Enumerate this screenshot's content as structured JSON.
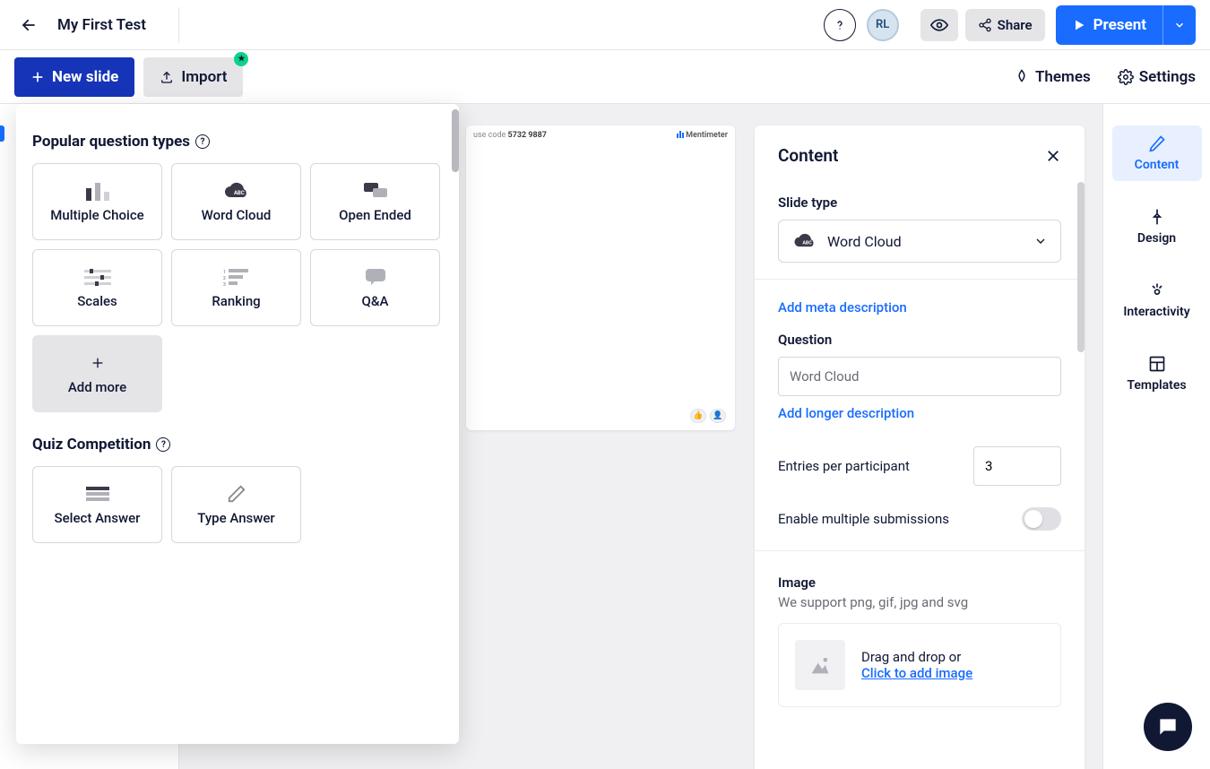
{
  "header": {
    "title": "My First Test",
    "avatar_initials": "RL",
    "share_label": "Share",
    "present_label": "Present"
  },
  "secondbar": {
    "new_slide_label": "New slide",
    "import_label": "Import",
    "themes_label": "Themes",
    "settings_label": "Settings"
  },
  "popover": {
    "popular_title": "Popular question types",
    "quiz_title": "Quiz Competition",
    "cards": {
      "multiple_choice": "Multiple Choice",
      "word_cloud": "Word Cloud",
      "open_ended": "Open Ended",
      "scales": "Scales",
      "ranking": "Ranking",
      "qa": "Q&A",
      "add_more": "Add more",
      "select_answer": "Select Answer",
      "type_answer": "Type Answer"
    }
  },
  "preview": {
    "use_code_prefix": "use code",
    "code": "5732 9887",
    "brand": "Mentimeter"
  },
  "content_panel": {
    "title": "Content",
    "slide_type_label": "Slide type",
    "slide_type_value": "Word Cloud",
    "add_meta_link": "Add meta description",
    "question_label": "Question",
    "question_value": "Word Cloud",
    "add_longer_link": "Add longer description",
    "entries_label": "Entries per participant",
    "entries_value": "3",
    "multi_submit_label": "Enable multiple submissions",
    "multi_submit_enabled": false,
    "image_label": "Image",
    "image_support_text": "We support png, gif, jpg and svg",
    "drop_text1": "Drag and drop or",
    "drop_link": "Click to add image"
  },
  "rtabs": {
    "content": "Content",
    "design": "Design",
    "interactivity": "Interactivity",
    "templates": "Templates"
  }
}
